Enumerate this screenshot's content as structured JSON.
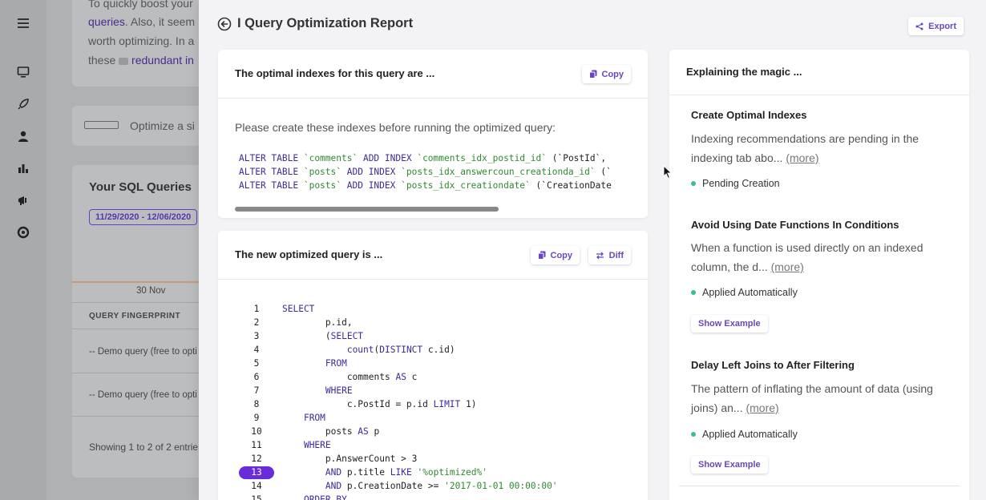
{
  "background": {
    "intro_lines": [
      "To quickly boost your",
      "queries. Also, it seem",
      "worth optimizing. In a",
      "these"
    ],
    "intro_link_queries": "queries",
    "intro_link_redundant": "redundant in",
    "optimize_text": "Optimize a si",
    "section_title": "Your SQL Queries",
    "date_range": "11/29/2020 - 12/06/2020",
    "chart_label": "30 Nov",
    "table_header": "QUERY FINGERPRINT",
    "rows": [
      "-- Demo query (free to opti",
      "-- Demo query (free to opti"
    ],
    "showing": "Showing 1 to 2 of 2 entrie"
  },
  "panel": {
    "title": "I Query Optimization Report",
    "export_label": "Export"
  },
  "indexes_card": {
    "title": "The optimal indexes for this query are ...",
    "copy_label": "Copy",
    "instruction": "Please create these indexes before running the optimized query:",
    "statements": [
      {
        "table": "`comments`",
        "index": "`comments_idx_postid_id`",
        "cols": "(`PostId`,"
      },
      {
        "table": "`posts`",
        "index": "`posts_idx_answercoun_creationda_id`",
        "cols": "(`"
      },
      {
        "table": "`posts`",
        "index": "`posts_idx_creationdate`",
        "cols": "(`CreationDate"
      }
    ]
  },
  "query_card": {
    "title": "The new optimized query is ...",
    "copy_label": "Copy",
    "diff_label": "Diff",
    "highlighted_line": 13,
    "lines": [
      {
        "n": "1",
        "text": "SELECT"
      },
      {
        "n": "2",
        "text": "        p.id,"
      },
      {
        "n": "3",
        "text": "        (SELECT"
      },
      {
        "n": "4",
        "text": "            count(DISTINCT c.id)"
      },
      {
        "n": "5",
        "text": "        FROM"
      },
      {
        "n": "6",
        "text": "            comments AS c"
      },
      {
        "n": "7",
        "text": "        WHERE"
      },
      {
        "n": "8",
        "text": "            c.PostId = p.id LIMIT 1)"
      },
      {
        "n": "9",
        "text": "    FROM"
      },
      {
        "n": "10",
        "text": "        posts AS p"
      },
      {
        "n": "11",
        "text": "    WHERE"
      },
      {
        "n": "12",
        "text": "        p.AnswerCount > 3"
      },
      {
        "n": "13",
        "text": "        AND p.title LIKE '%optimized%'"
      },
      {
        "n": "14",
        "text": "        AND p.CreationDate >= '2017-01-01 00:00:00'"
      },
      {
        "n": "15",
        "text": "    ORDER BY"
      }
    ]
  },
  "explain_card": {
    "title": "Explaining the magic ...",
    "more_label": "(more)",
    "items": [
      {
        "title": "Create Optimal Indexes",
        "desc_1": "Indexing recommendations are pending in the",
        "desc_2": "indexing tab abo...",
        "status": "Pending Creation"
      },
      {
        "title": "Avoid Using Date Functions In Conditions",
        "desc_1": "When a function is used directly on an indexed",
        "desc_2": "column, the d...",
        "status": "Applied Automatically",
        "button": "Show Example"
      },
      {
        "title": "Delay Left Joins to After Filtering",
        "desc_1": "The pattern of inflating the amount of data (using",
        "desc_2": "joins) an...",
        "status": "Applied Automatically",
        "button": "Show Example"
      }
    ]
  },
  "colors": {
    "accent": "#6b46c1",
    "highlight": "#6a2bd8",
    "status_dot": "#3bc08a"
  }
}
